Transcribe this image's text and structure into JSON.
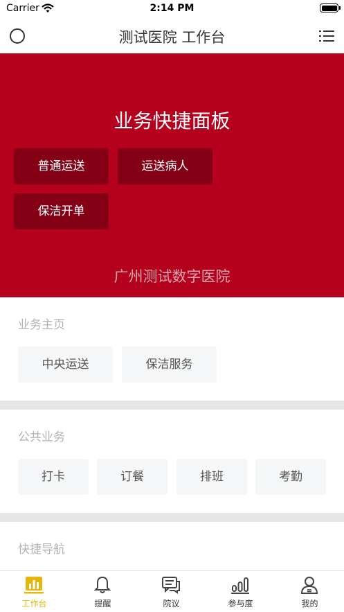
{
  "status_bar": {
    "carrier": "Carrier",
    "time": "2:14 PM"
  },
  "nav": {
    "title": "测试医院 工作台",
    "left_icon": "circle-icon",
    "right_icon": "list-icon"
  },
  "banner": {
    "title": "业务快捷面板",
    "buttons": [
      "普通运送",
      "运送病人",
      "保洁开单"
    ],
    "footer": "广州测试数字医院",
    "background": "#b5001e"
  },
  "business_home": {
    "title": "业务主页",
    "items": [
      "中央运送",
      "保洁服务"
    ]
  },
  "public_business": {
    "title": "公共业务",
    "items": [
      "打卡",
      "订餐",
      "排班",
      "考勤"
    ]
  },
  "quick_nav": {
    "title": "快捷导航"
  },
  "tab_bar": {
    "active_color": "#e7b60c",
    "tabs": [
      {
        "label": "工作台",
        "icon": "bar-chart-icon",
        "active": true
      },
      {
        "label": "提醒",
        "icon": "bell-icon",
        "active": false
      },
      {
        "label": "院议",
        "icon": "chat-icon",
        "active": false
      },
      {
        "label": "参与度",
        "icon": "stats-icon",
        "active": false
      },
      {
        "label": "我的",
        "icon": "user-icon",
        "active": false
      }
    ]
  }
}
